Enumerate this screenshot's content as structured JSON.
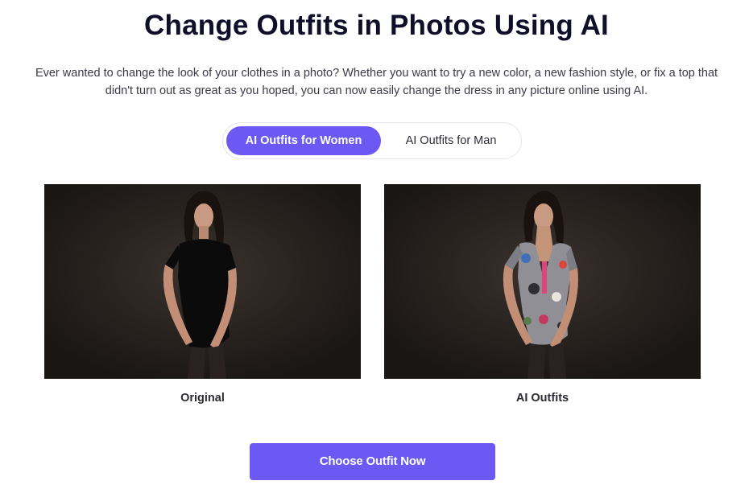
{
  "header": {
    "title": "Change Outfits in Photos Using AI",
    "description_line1": "Ever wanted to change the look of your clothes in a photo? Whether you want to try a new color, a new fashion style, or fix a top that",
    "description_line2": "didn't turn out as great as you hoped, you can now easily change the dress in any picture online using AI."
  },
  "tabs": [
    {
      "label": "AI Outfits for Women",
      "active": true
    },
    {
      "label": "AI Outfits for Man",
      "active": false
    }
  ],
  "comparison": {
    "original_caption": "Original",
    "ai_caption": "AI Outfits"
  },
  "cta": {
    "label": "Choose Outfit Now"
  },
  "colors": {
    "accent": "#6c58f3",
    "title": "#0f0f2a",
    "photo_background": "#1d1917"
  }
}
